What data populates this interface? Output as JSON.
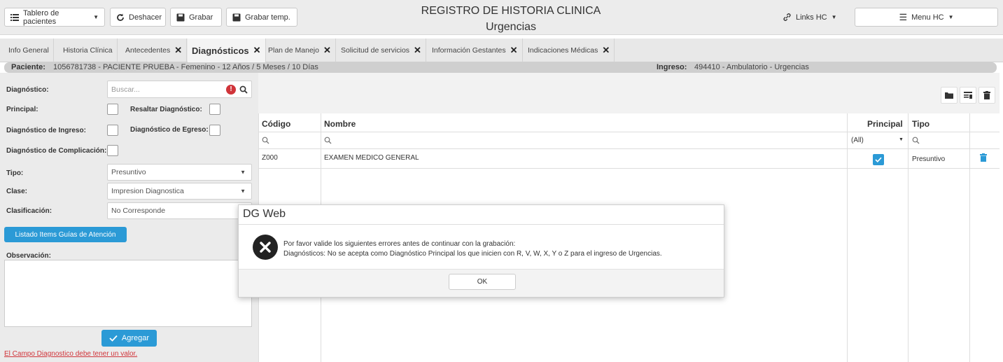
{
  "toolbar": {
    "patients_board": "Tablero de pacientes",
    "undo": "Deshacer",
    "save": "Grabar",
    "save_temp": "Grabar temp.",
    "title": "REGISTRO DE HISTORIA CLINICA",
    "subtitle": "Urgencias",
    "links": "Links HC",
    "menu": "Menu HC"
  },
  "tabs": [
    {
      "label": "Info General"
    },
    {
      "label": "Historia Clínica"
    },
    {
      "label": "Antecedentes"
    },
    {
      "label": "Diagnósticos"
    },
    {
      "label": "Plan de Manejo"
    },
    {
      "label": "Solicitud de servicios"
    },
    {
      "label": "Información Gestantes"
    },
    {
      "label": "Indicaciones Médicas"
    }
  ],
  "patient": {
    "label": "Paciente:",
    "value": "1056781738 - PACIENTE PRUEBA - Femenino - 12 Años / 5 Meses / 10 Días",
    "admission_label": "Ingreso:",
    "admission_value": "494410 - Ambulatorio - Urgencias"
  },
  "form": {
    "diagnosis_label": "Diagnóstico:",
    "search_placeholder": "Buscar...",
    "principal_label": "Principal:",
    "highlight_label": "Resaltar Diagnóstico:",
    "admission_dx_label": "Diagnóstico de Ingreso:",
    "discharge_dx_label": "Diagnóstico de Egreso:",
    "complication_label": "Diagnóstico de Complicación:",
    "type_label": "Tipo:",
    "type_value": "Presuntivo",
    "class_label": "Clase:",
    "class_value": "Impresion Diagnostica",
    "classification_label": "Clasificación:",
    "classification_value": "No Corresponde",
    "guides_button": "Listado Items Guías de Atención",
    "observation_label": "Observación:",
    "add_button": "Agregar",
    "error_text": "El Campo Diagnostico debe tener un valor."
  },
  "grid": {
    "columns": [
      "Código",
      "Nombre",
      "Principal",
      "Tipo"
    ],
    "filter_all": "(All)",
    "rows": [
      {
        "code": "Z000",
        "name": "EXAMEN MEDICO GENERAL",
        "principal": true,
        "type": "Presuntivo"
      }
    ]
  },
  "modal": {
    "title": "DG Web",
    "line1": "Por favor valide los siguientes errores antes de continuar con la grabación:",
    "line2": "Diagnósticos: No se acepta como Diagnóstico Principal los que inicien con R, V, W, X, Y o Z para el ingreso de Urgencias.",
    "ok": "OK"
  },
  "colors": {
    "accent": "#2b9ad6",
    "error": "#d0343a"
  }
}
